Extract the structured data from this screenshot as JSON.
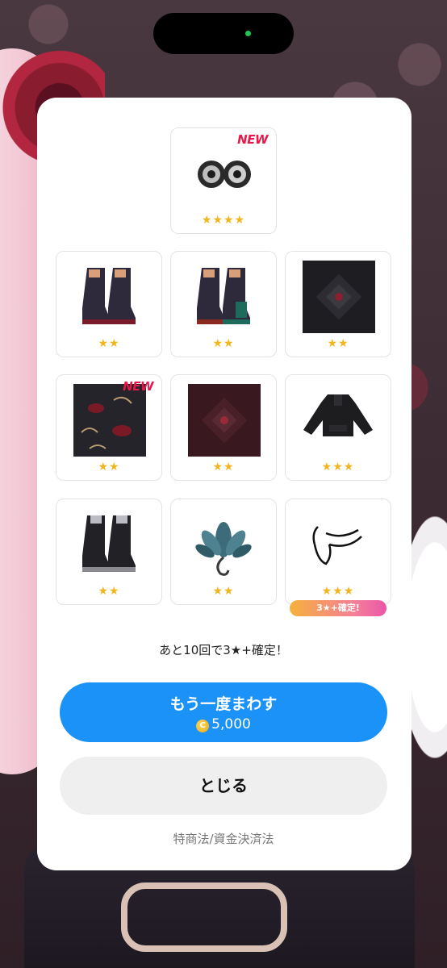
{
  "items": [
    {
      "name": "earrings",
      "stars": "★★★★",
      "new": "NEW"
    },
    {
      "name": "boots-red",
      "stars": "★★",
      "new": ""
    },
    {
      "name": "boots-green",
      "stars": "★★",
      "new": ""
    },
    {
      "name": "dark-tile",
      "stars": "★★",
      "new": ""
    },
    {
      "name": "lotus-fabric",
      "stars": "★★",
      "new": "NEW"
    },
    {
      "name": "red-tile",
      "stars": "★★",
      "new": ""
    },
    {
      "name": "black-jacket",
      "stars": "★★★",
      "new": ""
    },
    {
      "name": "gray-boots",
      "stars": "★★",
      "new": ""
    },
    {
      "name": "blue-flower",
      "stars": "★★",
      "new": ""
    },
    {
      "name": "glasses",
      "stars": "★★★",
      "new": ""
    }
  ],
  "badge": "3★+確定!",
  "remaining_text": "あと10回で3★+確定！",
  "spin_again": {
    "label": "もう一度まわす",
    "coin": "C",
    "price": "5,000"
  },
  "close_label": "とじる",
  "legal_link": "特商法/資金決済法",
  "colors": {
    "primary": "#1a92f7",
    "star": "#f3b51c",
    "new": "#e8194a"
  }
}
